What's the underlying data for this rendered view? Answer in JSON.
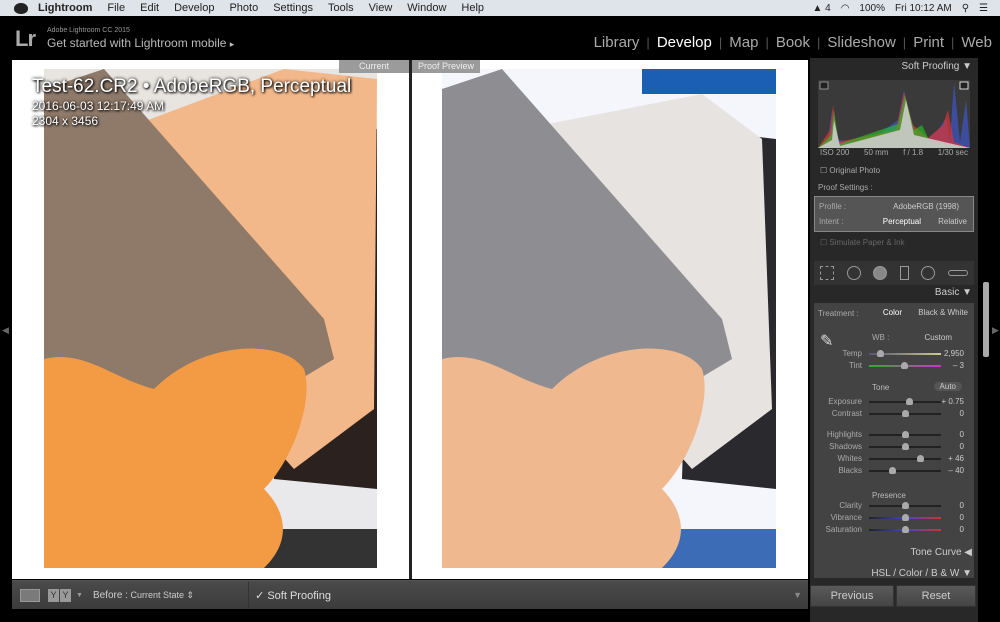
{
  "menubar": {
    "app": "Lightroom",
    "items": [
      "File",
      "Edit",
      "Develop",
      "Photo",
      "Settings",
      "Tools",
      "View",
      "Window",
      "Help"
    ],
    "status": {
      "adobe_count": "4",
      "battery": "100%",
      "clock": "Fri 10:12 AM"
    }
  },
  "identity": {
    "logo": "Lr",
    "product": "Adobe Lightroom CC 2015",
    "message": "Get started with Lightroom mobile",
    "message_arrow": "▸"
  },
  "modules": [
    {
      "label": "Library",
      "active": false
    },
    {
      "label": "Develop",
      "active": true
    },
    {
      "label": "Map",
      "active": false
    },
    {
      "label": "Book",
      "active": false
    },
    {
      "label": "Slideshow",
      "active": false
    },
    {
      "label": "Print",
      "active": false
    },
    {
      "label": "Web",
      "active": false
    }
  ],
  "viewer": {
    "left_tag": "Current",
    "right_tag": "Proof Preview",
    "overlay": {
      "title": "Test-62.CR2  •  AdobeRGB, Perceptual",
      "datetime": "2016-06-03 12:17:49 AM",
      "dimensions": "2304 x 3456"
    }
  },
  "toolbar": {
    "before_label": "Before :",
    "before_value": "Current State",
    "soft_proofing_check": "✓",
    "soft_proofing": "Soft Proofing"
  },
  "panel": {
    "soft_proofing": {
      "header": "Soft Proofing",
      "meta": [
        "ISO 200",
        "50 mm",
        "f / 1.8",
        "1/30 sec"
      ],
      "original_photo": "Original Photo",
      "proof_settings": "Proof Settings :",
      "profile_label": "Profile :",
      "profile_value": "AdobeRGB (1998)",
      "intent_label": "Intent :",
      "intent_options": [
        "Perceptual",
        "Relative"
      ],
      "intent_selected": "Perceptual",
      "simulate": "Simulate Paper & Ink"
    },
    "basic": {
      "header": "Basic",
      "treatment_label": "Treatment :",
      "treatment_options": [
        "Color",
        "Black & White"
      ],
      "treatment_selected": "Color",
      "wb_label": "WB :",
      "wb_value": "Custom",
      "sliders": [
        {
          "label": "Temp",
          "value": "2,950",
          "pos": 0.15
        },
        {
          "label": "Tint",
          "value": "– 3",
          "pos": 0.49
        },
        {
          "label": "Exposure",
          "value": "+ 0.75",
          "pos": 0.56
        },
        {
          "label": "Contrast",
          "value": "0",
          "pos": 0.5
        },
        {
          "label": "Highlights",
          "value": "0",
          "pos": 0.5
        },
        {
          "label": "Shadows",
          "value": "0",
          "pos": 0.5
        },
        {
          "label": "Whites",
          "value": "+ 46",
          "pos": 0.71
        },
        {
          "label": "Blacks",
          "value": "– 40",
          "pos": 0.32
        },
        {
          "label": "Clarity",
          "value": "0",
          "pos": 0.5
        },
        {
          "label": "Vibrance",
          "value": "0",
          "pos": 0.5
        },
        {
          "label": "Saturation",
          "value": "0",
          "pos": 0.5
        }
      ],
      "tone_label": "Tone",
      "auto_label": "Auto",
      "presence_label": "Presence"
    },
    "tone_curve": "Tone Curve",
    "hsl": "HSL  /  Color  /  B & W",
    "previous": "Previous",
    "reset": "Reset"
  }
}
